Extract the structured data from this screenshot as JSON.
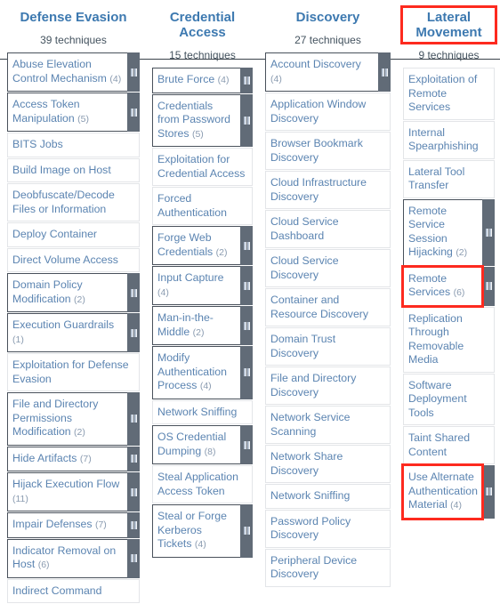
{
  "matrix": {
    "highlight_color": "#fd2a1f",
    "accent_color": "#3d79b0",
    "link_color": "#5b84b1",
    "handle_color": "#616b77",
    "columns": [
      {
        "title": "Defense Evasion",
        "count_label": "39 techniques",
        "title_highlighted": false,
        "techniques": [
          {
            "name": "Abuse Elevation Control Mechanism",
            "sub": "(4)",
            "has_sub": true,
            "highlighted": false
          },
          {
            "name": "Access Token Manipulation",
            "sub": "(5)",
            "has_sub": true,
            "highlighted": false
          },
          {
            "name": "BITS Jobs",
            "sub": "",
            "has_sub": false,
            "highlighted": false
          },
          {
            "name": "Build Image on Host",
            "sub": "",
            "has_sub": false,
            "highlighted": false
          },
          {
            "name": "Deobfuscate/Decode Files or Information",
            "sub": "",
            "has_sub": false,
            "highlighted": false
          },
          {
            "name": "Deploy Container",
            "sub": "",
            "has_sub": false,
            "highlighted": false
          },
          {
            "name": "Direct Volume Access",
            "sub": "",
            "has_sub": false,
            "highlighted": false
          },
          {
            "name": "Domain Policy Modification",
            "sub": "(2)",
            "has_sub": true,
            "highlighted": false
          },
          {
            "name": "Execution Guardrails",
            "sub": "(1)",
            "has_sub": true,
            "highlighted": false
          },
          {
            "name": "Exploitation for Defense Evasion",
            "sub": "",
            "has_sub": false,
            "highlighted": false
          },
          {
            "name": "File and Directory Permissions Modification",
            "sub": "(2)",
            "has_sub": true,
            "highlighted": false
          },
          {
            "name": "Hide Artifacts",
            "sub": "(7)",
            "has_sub": true,
            "highlighted": false
          },
          {
            "name": "Hijack Execution Flow",
            "sub": "(11)",
            "has_sub": true,
            "highlighted": false
          },
          {
            "name": "Impair Defenses",
            "sub": "(7)",
            "has_sub": true,
            "highlighted": false
          },
          {
            "name": "Indicator Removal on Host",
            "sub": "(6)",
            "has_sub": true,
            "highlighted": false
          },
          {
            "name": "Indirect Command",
            "sub": "",
            "has_sub": false,
            "highlighted": false
          }
        ]
      },
      {
        "title": "Credential Access",
        "count_label": "15 techniques",
        "title_highlighted": false,
        "techniques": [
          {
            "name": "Brute Force",
            "sub": "(4)",
            "has_sub": true,
            "highlighted": false
          },
          {
            "name": "Credentials from Password Stores",
            "sub": "(5)",
            "has_sub": true,
            "highlighted": false
          },
          {
            "name": "Exploitation for Credential Access",
            "sub": "",
            "has_sub": false,
            "highlighted": false
          },
          {
            "name": "Forced Authentication",
            "sub": "",
            "has_sub": false,
            "highlighted": false
          },
          {
            "name": "Forge Web Credentials",
            "sub": "(2)",
            "has_sub": true,
            "highlighted": false
          },
          {
            "name": "Input Capture",
            "sub": "(4)",
            "has_sub": true,
            "highlighted": false
          },
          {
            "name": "Man-in-the-Middle",
            "sub": "(2)",
            "has_sub": true,
            "highlighted": false
          },
          {
            "name": "Modify Authentication Process",
            "sub": "(4)",
            "has_sub": true,
            "highlighted": false
          },
          {
            "name": "Network Sniffing",
            "sub": "",
            "has_sub": false,
            "highlighted": false
          },
          {
            "name": "OS Credential Dumping",
            "sub": "(8)",
            "has_sub": true,
            "highlighted": false
          },
          {
            "name": "Steal Application Access Token",
            "sub": "",
            "has_sub": false,
            "highlighted": false
          },
          {
            "name": "Steal or Forge Kerberos Tickets",
            "sub": "(4)",
            "has_sub": true,
            "highlighted": false
          }
        ]
      },
      {
        "title": "Discovery",
        "count_label": "27 techniques",
        "title_highlighted": false,
        "techniques": [
          {
            "name": "Account Discovery",
            "sub": "(4)",
            "has_sub": true,
            "highlighted": false
          },
          {
            "name": "Application Window Discovery",
            "sub": "",
            "has_sub": false,
            "highlighted": false
          },
          {
            "name": "Browser Bookmark Discovery",
            "sub": "",
            "has_sub": false,
            "highlighted": false
          },
          {
            "name": "Cloud Infrastructure Discovery",
            "sub": "",
            "has_sub": false,
            "highlighted": false
          },
          {
            "name": "Cloud Service Dashboard",
            "sub": "",
            "has_sub": false,
            "highlighted": false
          },
          {
            "name": "Cloud Service Discovery",
            "sub": "",
            "has_sub": false,
            "highlighted": false
          },
          {
            "name": "Container and Resource Discovery",
            "sub": "",
            "has_sub": false,
            "highlighted": false
          },
          {
            "name": "Domain Trust Discovery",
            "sub": "",
            "has_sub": false,
            "highlighted": false
          },
          {
            "name": "File and Directory Discovery",
            "sub": "",
            "has_sub": false,
            "highlighted": false
          },
          {
            "name": "Network Service Scanning",
            "sub": "",
            "has_sub": false,
            "highlighted": false
          },
          {
            "name": "Network Share Discovery",
            "sub": "",
            "has_sub": false,
            "highlighted": false
          },
          {
            "name": "Network Sniffing",
            "sub": "",
            "has_sub": false,
            "highlighted": false
          },
          {
            "name": "Password Policy Discovery",
            "sub": "",
            "has_sub": false,
            "highlighted": false
          },
          {
            "name": "Peripheral Device Discovery",
            "sub": "",
            "has_sub": false,
            "highlighted": false
          }
        ]
      },
      {
        "title": "Lateral Movement",
        "count_label": "9 techniques",
        "title_highlighted": true,
        "techniques": [
          {
            "name": "Exploitation of Remote Services",
            "sub": "",
            "has_sub": false,
            "highlighted": false
          },
          {
            "name": "Internal Spearphishing",
            "sub": "",
            "has_sub": false,
            "highlighted": false
          },
          {
            "name": "Lateral Tool Transfer",
            "sub": "",
            "has_sub": false,
            "highlighted": false
          },
          {
            "name": "Remote Service Session Hijacking",
            "sub": "(2)",
            "has_sub": true,
            "highlighted": false
          },
          {
            "name": "Remote Services",
            "sub": "(6)",
            "has_sub": true,
            "highlighted": true
          },
          {
            "name": "Replication Through Removable Media",
            "sub": "",
            "has_sub": false,
            "highlighted": false
          },
          {
            "name": "Software Deployment Tools",
            "sub": "",
            "has_sub": false,
            "highlighted": false
          },
          {
            "name": "Taint Shared Content",
            "sub": "",
            "has_sub": false,
            "highlighted": false
          },
          {
            "name": "Use Alternate Authentication Material",
            "sub": "(4)",
            "has_sub": true,
            "highlighted": true
          }
        ]
      }
    ]
  }
}
